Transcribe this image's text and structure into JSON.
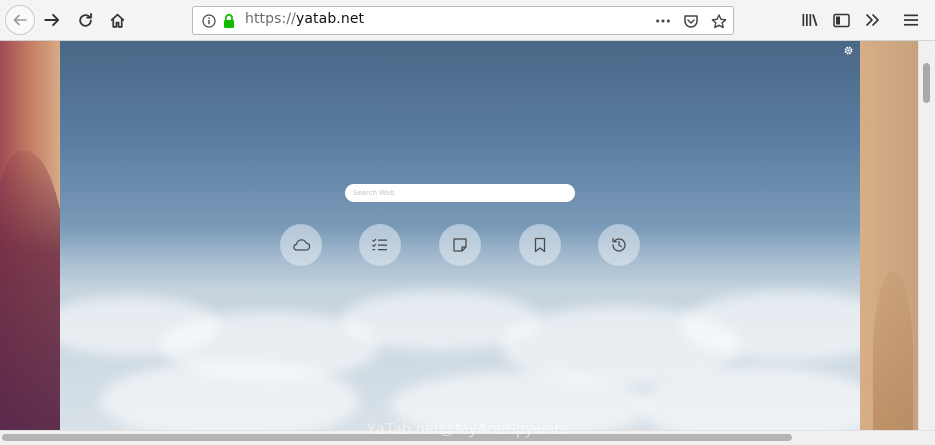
{
  "browser": {
    "url_scheme": "https://",
    "url_host": "yatab.net",
    "icons": {
      "back": "back-arrow-icon",
      "forward": "forward-arrow-icon",
      "reload": "reload-icon",
      "home": "home-icon",
      "info": "info-icon",
      "lock": "lock-icon",
      "page_actions": "more-dots-icon",
      "pocket": "pocket-icon",
      "bookmark_star": "star-icon",
      "library": "library-icon",
      "sidebar": "sidebar-icon",
      "overflow": "chevron-double-right-icon",
      "menu": "hamburger-menu-icon"
    },
    "lock_color": "#12bc00"
  },
  "newtab": {
    "search_placeholder": "Search Web",
    "settings_icon": "gear-icon",
    "tiles": [
      {
        "icon": "weather-cloud-icon"
      },
      {
        "icon": "todo-checklist-icon"
      },
      {
        "icon": "notes-icon"
      },
      {
        "icon": "bookmark-icon"
      },
      {
        "icon": "history-clock-icon"
      }
    ]
  },
  "watermark": "YaTab.net@MyAntiSpyware"
}
